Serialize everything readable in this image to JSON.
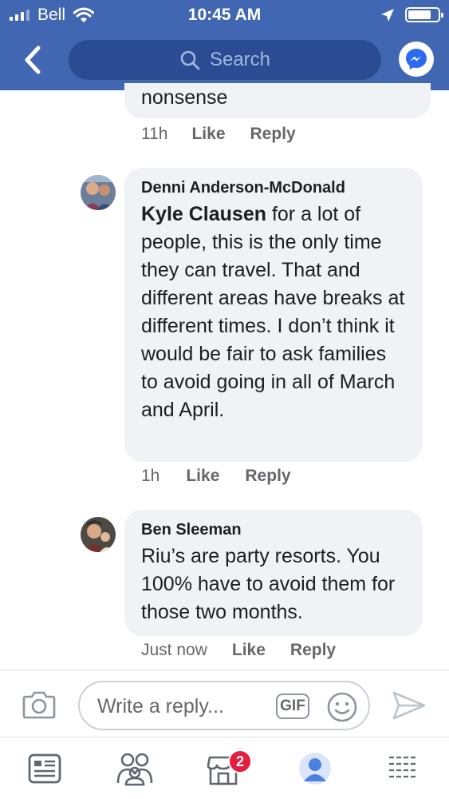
{
  "status_bar": {
    "carrier": "Bell",
    "time": "10:45 AM"
  },
  "header": {
    "search_placeholder": "Search",
    "icons": [
      "back-icon",
      "search-icon",
      "messenger-icon"
    ]
  },
  "previous_comment": {
    "text_tail": "nonsense",
    "time": "11h",
    "like_label": "Like",
    "reply_label": "Reply"
  },
  "comments": [
    {
      "author": "Denni Anderson-McDonald",
      "mention": "Kyle Clausen",
      "text": " for a lot of people, this is the only time they can travel. That and different areas have breaks at different times. I don’t think it would be fair to ask families to avoid going in all of March and April.",
      "time": "1h",
      "like_label": "Like",
      "reply_label": "Reply"
    },
    {
      "author": "Ben Sleeman",
      "text": "Riu’s are party resorts. You 100% have to avoid them for those two months.",
      "time": "Just now",
      "like_label": "Like",
      "reply_label": "Reply"
    }
  ],
  "composer": {
    "placeholder": "Write a reply...",
    "gif_label": "GIF",
    "icons": [
      "camera-icon",
      "emoji-icon",
      "send-icon"
    ]
  },
  "tab_bar": {
    "marketplace_badge": "2",
    "tabs": [
      "news-feed-icon",
      "groups-icon",
      "marketplace-icon",
      "profile-icon",
      "menu-icon"
    ]
  },
  "colors": {
    "brand_blue": "#4267b2",
    "search_bg": "#2b4c92",
    "bubble_bg": "#f0f2f5",
    "badge_red": "#e41e3f"
  }
}
